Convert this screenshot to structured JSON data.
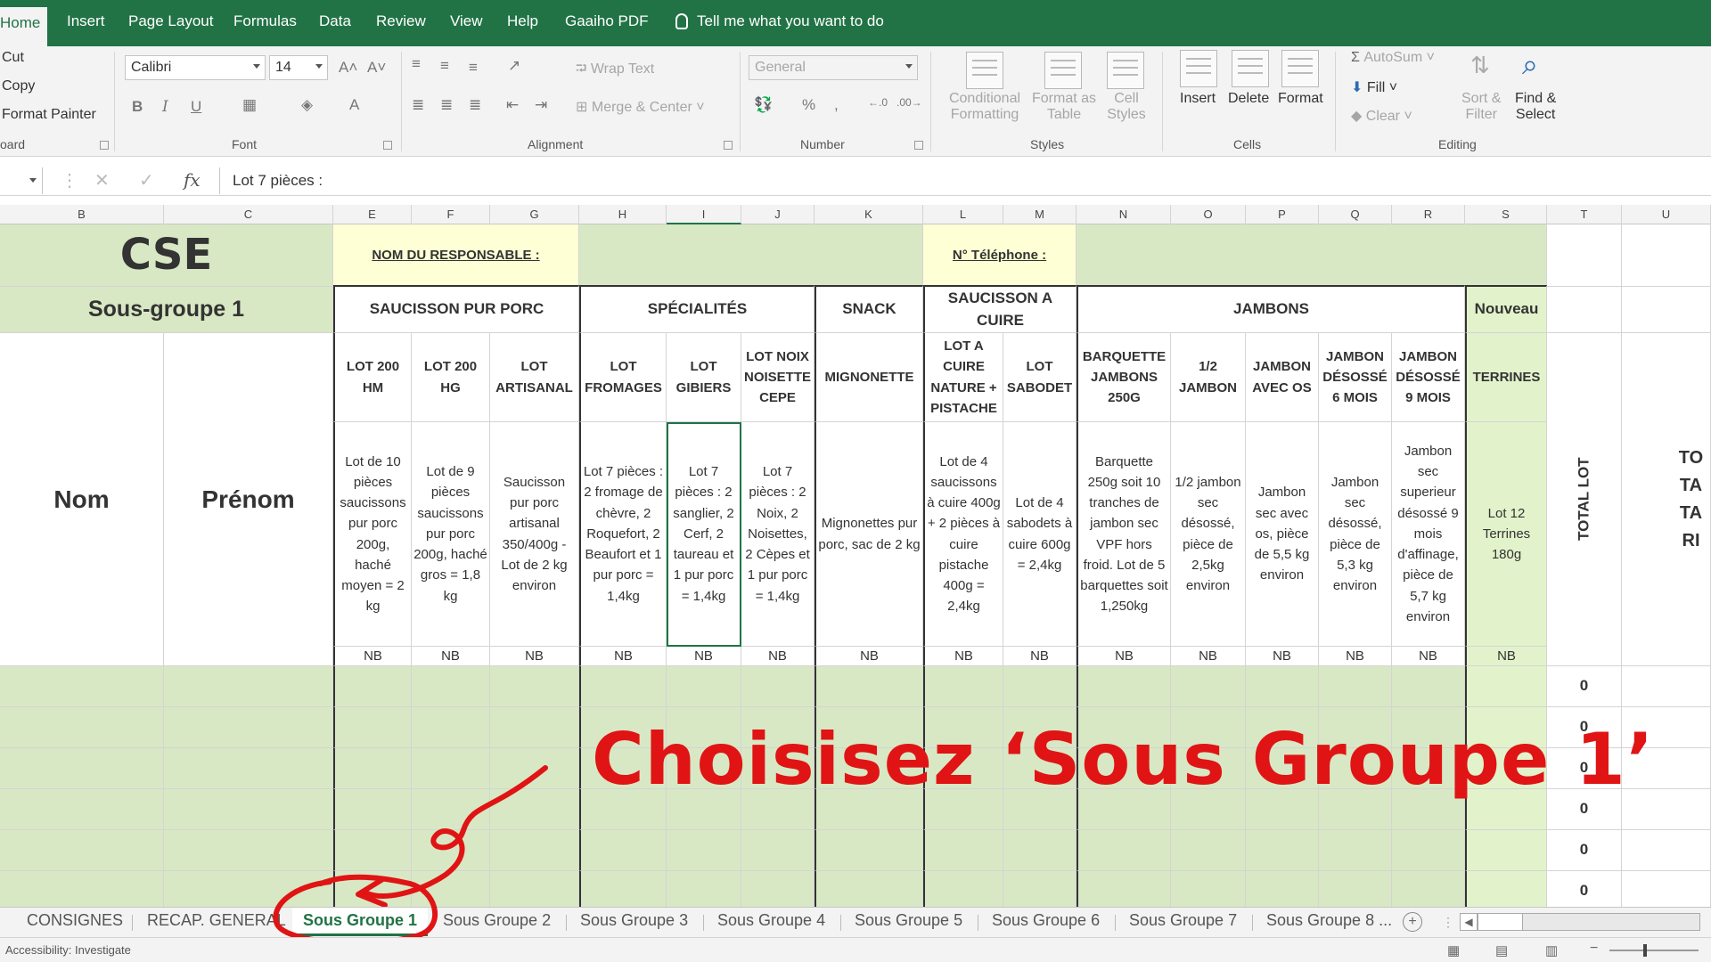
{
  "ribbon_tabs": [
    "Home",
    "Insert",
    "Page Layout",
    "Formulas",
    "Data",
    "Review",
    "View",
    "Help",
    "Gaaiho PDF"
  ],
  "tell_me": "Tell me what you want to do",
  "clipboard": {
    "cut": "Cut",
    "copy": "Copy",
    "format_painter": "Format Painter",
    "label": "oard"
  },
  "font": {
    "name": "Calibri",
    "size": "14",
    "label": "Font"
  },
  "alignment": {
    "wrap": "Wrap Text",
    "merge": "Merge & Center",
    "label": "Alignment"
  },
  "number": {
    "format": "General",
    "label": "Number"
  },
  "styles": {
    "cond": [
      "Conditional",
      "Formatting"
    ],
    "table": [
      "Format as",
      "Table"
    ],
    "cell": [
      "Cell",
      "Styles"
    ],
    "label": "Styles"
  },
  "cells": {
    "insert": "Insert",
    "delete": "Delete",
    "format": "Format",
    "label": "Cells"
  },
  "editing": {
    "autosum": "AutoSum",
    "fill": "Fill",
    "clear": "Clear",
    "sort": [
      "Sort &",
      "Filter"
    ],
    "find": [
      "Find &",
      "Select"
    ],
    "label": "Editing"
  },
  "formula_bar": {
    "content": "Lot 7 pièces :",
    "fx": "fx"
  },
  "columns": [
    "B",
    "C",
    "E",
    "F",
    "G",
    "H",
    "I",
    "J",
    "K",
    "L",
    "M",
    "N",
    "O",
    "P",
    "Q",
    "R",
    "S",
    "T",
    "U"
  ],
  "sheet": {
    "cse": "CSE",
    "subgroup": "Sous-groupe 1",
    "responsable": "NOM DU RESPONSABLE :",
    "telephone": "N° Téléphone :",
    "nom": "Nom",
    "prenom": "Prénom",
    "categories": [
      "SAUCISSON PUR PORC",
      "SPÉCIALITÉS",
      "SNACK",
      "SAUCISSON A CUIRE",
      "JAMBONS",
      "Nouveau"
    ],
    "products": [
      {
        "name": "LOT 200 HM",
        "desc": "Lot de 10 pièces saucissons pur porc 200g, haché moyen = 2 kg"
      },
      {
        "name": "LOT 200 HG",
        "desc": "Lot de 9 pièces saucissons pur porc 200g, haché gros = 1,8 kg"
      },
      {
        "name": "LOT ARTISANAL",
        "desc": "Saucisson pur porc artisanal 350/400g - Lot de 2 kg environ"
      },
      {
        "name": "LOT FROMAGES",
        "desc": "Lot 7 pièces : 2 fromage de chèvre, 2 Roquefort, 2 Beaufort et 1 pur porc = 1,4kg"
      },
      {
        "name": "LOT GIBIERS",
        "desc": "Lot 7 pièces : 2 sanglier, 2 Cerf, 2 taureau et 1 pur porc = 1,4kg"
      },
      {
        "name": "LOT NOIX NOISETTE CEPE",
        "desc": "Lot 7 pièces : 2 Noix, 2 Noisettes, 2 Cèpes et 1 pur porc = 1,4kg"
      },
      {
        "name": "MIGNONETTE",
        "desc": "Mignonettes pur porc, sac de 2 kg"
      },
      {
        "name": "LOT A CUIRE NATURE + PISTACHE",
        "desc": "Lot de 4 saucissons à cuire 400g + 2 pièces à cuire pistache 400g = 2,4kg"
      },
      {
        "name": "LOT SABODET",
        "desc": "Lot de 4 sabodets à cuire 600g = 2,4kg"
      },
      {
        "name": "BARQUETTE JAMBONS 250G",
        "desc": "Barquette 250g soit 10 tranches de jambon sec VPF hors froid. Lot de 5 barquettes soit 1,250kg"
      },
      {
        "name": "1/2 JAMBON",
        "desc": "1/2 jambon sec désossé, pièce de 2,5kg environ"
      },
      {
        "name": "JAMBON AVEC OS",
        "desc": "Jambon sec avec os, pièce de 5,5 kg environ"
      },
      {
        "name": "JAMBON DÉSOSSÉ 6 MOIS",
        "desc": "Jambon sec désossé, pièce de 5,3 kg environ"
      },
      {
        "name": "JAMBON DÉSOSSÉ 9 MOIS",
        "desc": "Jambon sec superieur désossé 9 mois d'affinage, pièce de 5,7 kg environ"
      },
      {
        "name": "TERRINES",
        "desc": "Lot 12 Terrines 180g"
      }
    ],
    "nb": "NB",
    "total_lot": "TOTAL LOT",
    "total_tarif": "TOTA TARI",
    "totals": [
      "0",
      "0",
      "0",
      "0",
      "0",
      "0"
    ]
  },
  "sheet_tabs": [
    "CONSIGNES",
    "RECAP. GENERAL",
    "Sous Groupe 1",
    "Sous Groupe 2",
    "Sous Groupe 3",
    "Sous Groupe 4",
    "Sous Groupe 5",
    "Sous Groupe 6",
    "Sous Groupe 7",
    "Sous Groupe 8 ..."
  ],
  "status_text": "Accessibility: Investigate",
  "annotation": "Choisisez ‘Sous Groupe 1’",
  "colors": {
    "excel_green": "#217346",
    "cell_green": "#d8e8c4",
    "annot_red": "#e01414"
  }
}
